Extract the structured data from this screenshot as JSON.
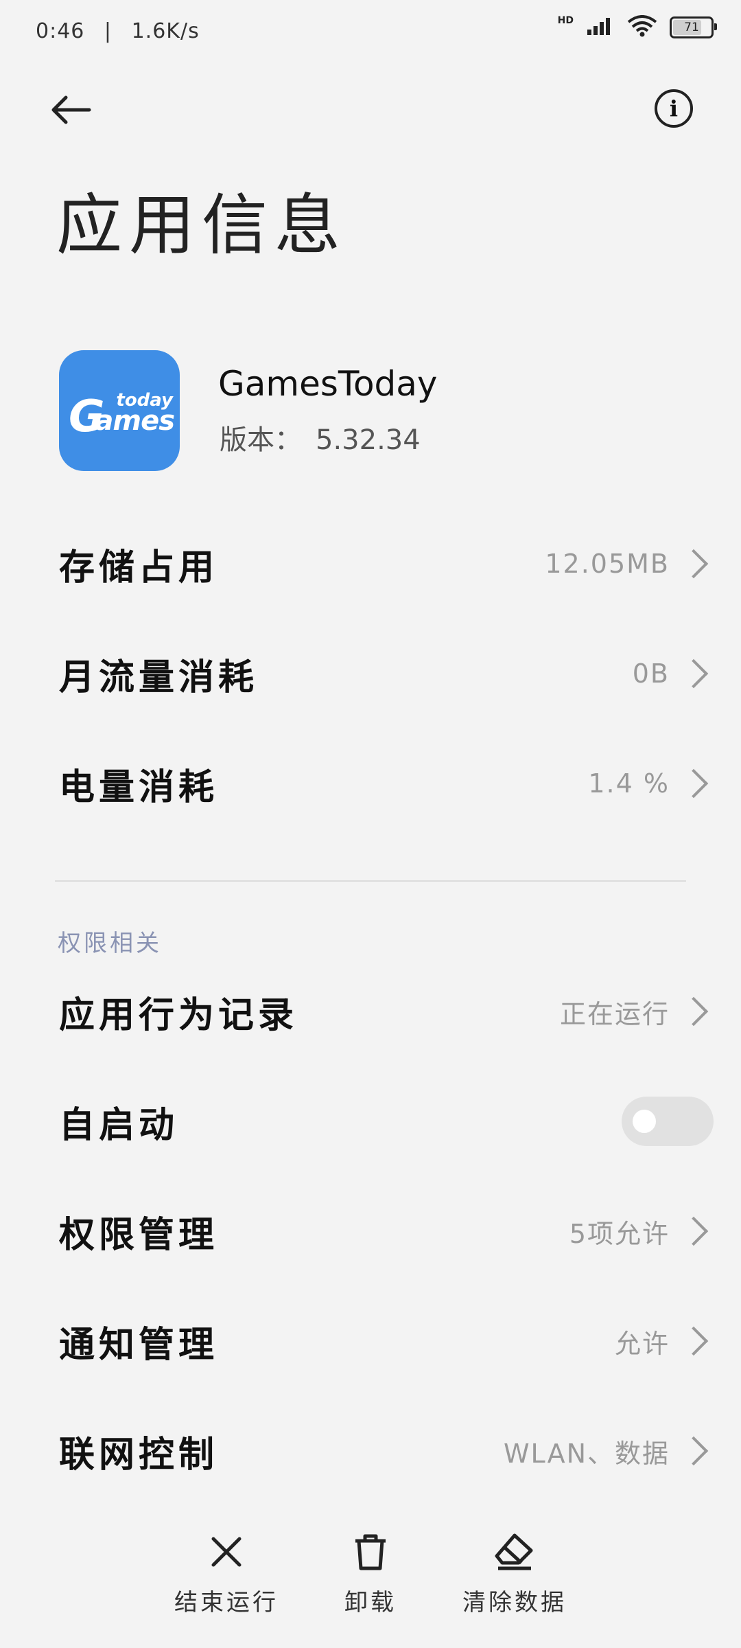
{
  "status_bar": {
    "time": "0:46",
    "separator": "|",
    "speed": "1.6K/s",
    "hd": "HD",
    "battery": "71"
  },
  "header": {
    "title": "应用信息"
  },
  "app": {
    "icon_text_small": "today",
    "icon_text_large": "ames",
    "icon_text_g": "G",
    "name": "GamesToday",
    "version_label": "版本：",
    "version_value": "5.32.34"
  },
  "rows_usage": [
    {
      "label": "存储占用",
      "value": "12.05MB"
    },
    {
      "label": "月流量消耗",
      "value": "0B"
    },
    {
      "label": "电量消耗",
      "value": "1.4 %"
    }
  ],
  "permissions": {
    "section_title": "权限相关",
    "rows": [
      {
        "label": "应用行为记录",
        "value": "正在运行"
      },
      {
        "label": "自启动",
        "toggle": false
      },
      {
        "label": "权限管理",
        "value": "5项允许"
      },
      {
        "label": "通知管理",
        "value": "允许"
      },
      {
        "label": "联网控制",
        "value": "WLAN、数据"
      }
    ]
  },
  "actions": [
    {
      "icon": "close-icon",
      "label": "结束运行"
    },
    {
      "icon": "trash-icon",
      "label": "卸载"
    },
    {
      "icon": "eraser-icon",
      "label": "清除数据"
    }
  ],
  "colors": {
    "background": "#f3f3f3",
    "app_icon": "#3f8ee6",
    "section_title": "#8a93b3",
    "value_text": "#999999"
  }
}
